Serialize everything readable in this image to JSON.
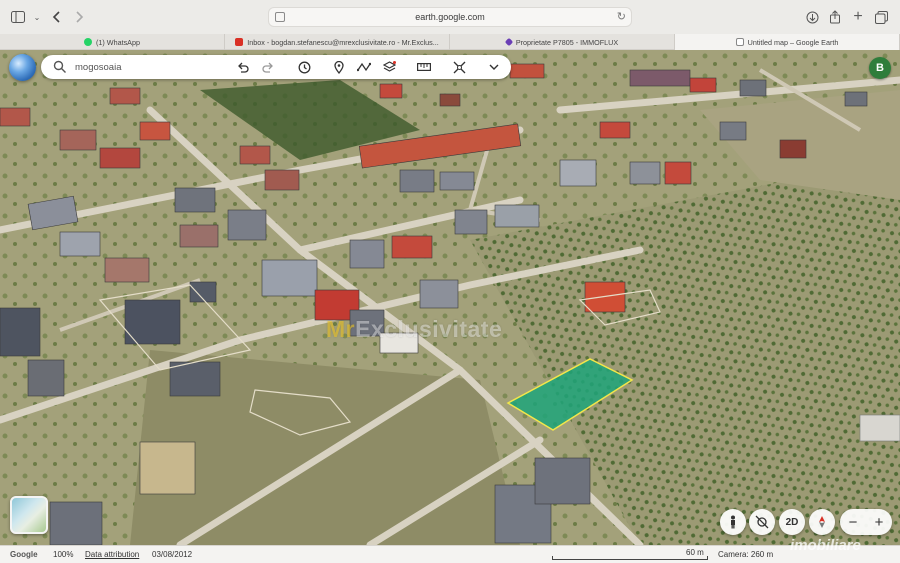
{
  "browser": {
    "url": "earth.google.com"
  },
  "tabs": [
    {
      "label": "(1) WhatsApp",
      "color": "#25d366"
    },
    {
      "label": "Inbox - bogdan.stefanescu@mrexclusivitate.ro - Mr.Exclus...",
      "color": "#d93025"
    },
    {
      "label": "Proprietate P7805 - IMMOFLUX",
      "color": "#6a3fb5"
    },
    {
      "label": "Untitled map – Google Earth",
      "color": "#8a8a8a"
    }
  ],
  "search": {
    "value": "mogosoaia"
  },
  "toolbar": {
    "icons": [
      "undo-icon",
      "redo-icon",
      "history-icon",
      "pin-icon",
      "path-icon",
      "layers-icon",
      "ruler-icon",
      "projects-icon",
      "chevron-down-icon"
    ]
  },
  "user": {
    "avatar_letter": "B"
  },
  "watermark": {
    "prefix": "Mr",
    "text": "Exclusivitate"
  },
  "map_controls": {
    "mode_2d": "2D"
  },
  "status": {
    "brand": "Google",
    "zoom": "100%",
    "attribution": "Data attribution",
    "date": "03/08/2012",
    "scale": "60 m",
    "camera": "Camera: 260 m"
  },
  "overlay_logo": "imobiliare",
  "colors": {
    "parcel_fill": "#1ea57a",
    "parcel_stroke": "#f2e64a",
    "avatar": "#2f7d3b"
  }
}
